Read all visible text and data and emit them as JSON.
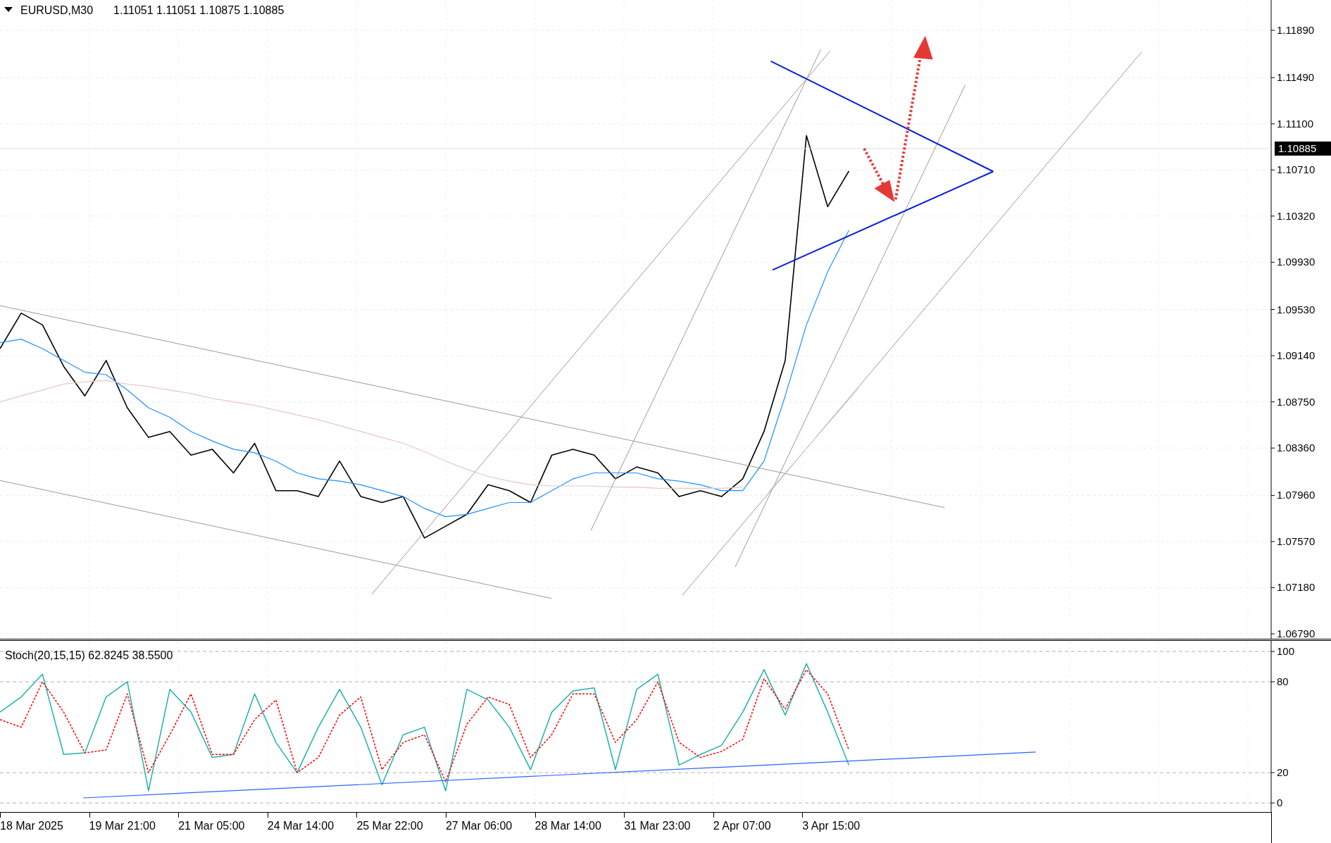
{
  "header": {
    "symbol": "EURUSD,M30",
    "ohlc": "1.11051 1.11051 1.10875 1.10885"
  },
  "price_chart": {
    "last_price": "1.10885",
    "chart_data": {
      "type": "line",
      "grid": true,
      "ylim": [
        1.0679,
        1.1189
      ],
      "yticks": [
        {
          "value": 1.1189,
          "label": "1.11890"
        },
        {
          "value": 1.1149,
          "label": "1.11490"
        },
        {
          "value": 1.111,
          "label": "1.11100"
        },
        {
          "value": 1.1071,
          "label": "1.10710"
        },
        {
          "value": 1.1032,
          "label": "1.10320"
        },
        {
          "value": 1.0993,
          "label": "1.09930"
        },
        {
          "value": 1.0953,
          "label": "1.09530"
        },
        {
          "value": 1.0914,
          "label": "1.09140"
        },
        {
          "value": 1.0875,
          "label": "1.08750"
        },
        {
          "value": 1.0836,
          "label": "1.08360"
        },
        {
          "value": 1.0796,
          "label": "1.07960"
        },
        {
          "value": 1.0757,
          "label": "1.07570"
        },
        {
          "value": 1.0718,
          "label": "1.07180"
        },
        {
          "value": 1.0679,
          "label": "1.06790"
        }
      ],
      "series": [
        {
          "color": "#000000",
          "values": [
            1.092,
            1.095,
            1.094,
            1.0905,
            1.088,
            1.091,
            1.087,
            1.0845,
            1.085,
            1.083,
            1.0835,
            1.0815,
            1.084,
            1.08,
            1.08,
            1.0795,
            1.0825,
            1.0795,
            1.079,
            1.0795,
            1.076,
            1.077,
            1.078,
            1.0805,
            1.08,
            1.079,
            1.083,
            1.0835,
            1.083,
            1.081,
            1.082,
            1.0815,
            1.0795,
            1.08,
            1.0795,
            1.081,
            1.085,
            1.091,
            1.11,
            1.104,
            1.107
          ]
        },
        {
          "color": "#1e90ff",
          "values": [
            1.0925,
            1.0928,
            1.092,
            1.091,
            1.09,
            1.0898,
            1.0885,
            1.087,
            1.0862,
            1.085,
            1.0842,
            1.0835,
            1.0832,
            1.0825,
            1.0815,
            1.081,
            1.0808,
            1.0805,
            1.08,
            1.0795,
            1.0785,
            1.0778,
            1.078,
            1.0785,
            1.079,
            1.079,
            1.08,
            1.081,
            1.0815,
            1.0815,
            1.0815,
            1.081,
            1.0808,
            1.0805,
            1.08,
            1.08,
            1.0825,
            1.088,
            1.094,
            1.0985,
            1.102
          ]
        },
        {
          "color": "#e6c8c8",
          "values": [
            1.0875,
            1.088,
            1.0885,
            1.089,
            1.0892,
            1.0893,
            1.089,
            1.0888,
            1.0885,
            1.0882,
            1.0878,
            1.0875,
            1.0872,
            1.0868,
            1.0864,
            1.086,
            1.0855,
            1.085,
            1.0845,
            1.084,
            1.0833,
            1.0825,
            1.0818,
            1.0812,
            1.0808,
            1.0805,
            1.0804,
            1.0804,
            1.0804,
            1.0803,
            1.0803,
            1.0802,
            1.0802,
            1.0802,
            1.0802,
            1.0803,
            null,
            null,
            null,
            null,
            null
          ]
        }
      ]
    }
  },
  "stochastic": {
    "label": "Stoch(20,15,15) 62.8245 38.5500",
    "chart_data": {
      "type": "line",
      "grid": true,
      "ylim": [
        -6,
        107
      ],
      "yticks": [
        {
          "value": 100,
          "label": "100"
        },
        {
          "value": 80,
          "label": "80"
        },
        {
          "value": 20,
          "label": "20"
        },
        {
          "value": 0,
          "label": "0"
        }
      ],
      "series": [
        {
          "color": "#20b2aa",
          "values": [
            60,
            70,
            85,
            32,
            33,
            70,
            80,
            8,
            75,
            60,
            30,
            32,
            72,
            40,
            20,
            50,
            75,
            50,
            12,
            45,
            50,
            8,
            75,
            68,
            50,
            22,
            60,
            74,
            76,
            22,
            75,
            85,
            25,
            32,
            38,
            60,
            88,
            58,
            92,
            60,
            25
          ]
        },
        {
          "color": "#ff0000",
          "line_style": "dotted",
          "values": [
            55,
            50,
            80,
            60,
            33,
            35,
            72,
            20,
            45,
            72,
            32,
            32,
            55,
            68,
            20,
            30,
            58,
            70,
            22,
            40,
            45,
            14,
            52,
            70,
            65,
            30,
            45,
            72,
            72,
            40,
            55,
            80,
            40,
            30,
            34,
            42,
            82,
            62,
            88,
            72,
            35
          ]
        }
      ]
    }
  },
  "time_axis": [
    "18 Mar 2025",
    "19 Mar 21:00",
    "21 Mar 05:00",
    "24 Mar 14:00",
    "25 Mar 22:00",
    "27 Mar 06:00",
    "28 Mar 14:00",
    "31 Mar 23:00",
    "2 Apr 07:00",
    "3 Apr 15:00"
  ]
}
